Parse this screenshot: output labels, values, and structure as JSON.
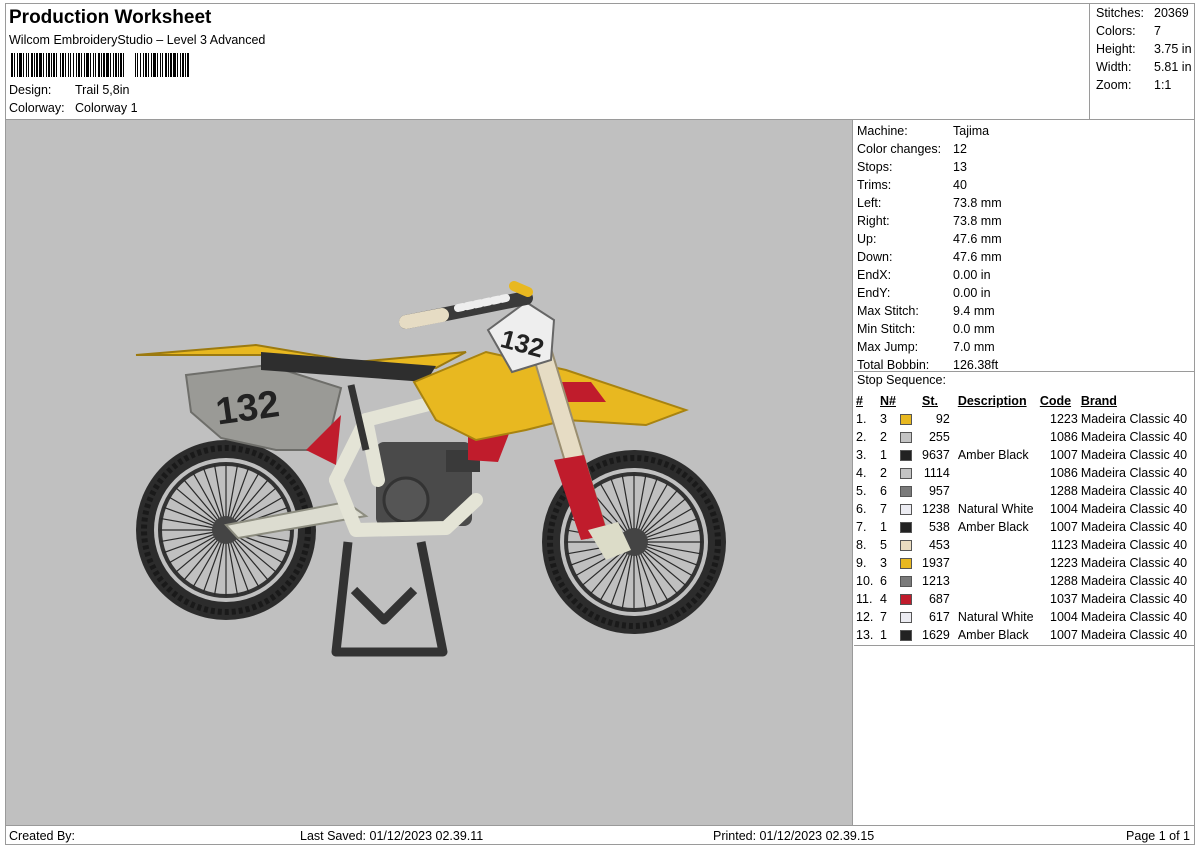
{
  "header": {
    "title": "Production Worksheet",
    "subtitle": "Wilcom EmbroideryStudio – Level 3 Advanced",
    "design_label": "Design:",
    "design_value": "Trail 5,8in",
    "colorway_label": "Colorway:",
    "colorway_value": "Colorway 1"
  },
  "summary": {
    "stitches_label": "Stitches:",
    "stitches_value": "20369",
    "colors_label": "Colors:",
    "colors_value": "7",
    "height_label": "Height:",
    "height_value": "3.75 in",
    "width_label": "Width:",
    "width_value": "5.81 in",
    "zoom_label": "Zoom:",
    "zoom_value": "1:1"
  },
  "machine_info": [
    {
      "label": "Machine:",
      "value": "Tajima"
    },
    {
      "label": "Color changes:",
      "value": "12"
    },
    {
      "label": "Stops:",
      "value": "13"
    },
    {
      "label": "Trims:",
      "value": "40"
    },
    {
      "label": "Left:",
      "value": "73.8 mm"
    },
    {
      "label": "Right:",
      "value": "73.8 mm"
    },
    {
      "label": "Up:",
      "value": "47.6 mm"
    },
    {
      "label": "Down:",
      "value": "47.6 mm"
    },
    {
      "label": "EndX:",
      "value": "0.00 in"
    },
    {
      "label": "EndY:",
      "value": "0.00 in"
    },
    {
      "label": "Max Stitch:",
      "value": "9.4 mm"
    },
    {
      "label": "Min Stitch:",
      "value": "0.0 mm"
    },
    {
      "label": "Max Jump:",
      "value": "7.0 mm"
    },
    {
      "label": "Total Bobbin:",
      "value": "126.38ft"
    }
  ],
  "stop_sequence": {
    "title": "Stop Sequence:",
    "headers": {
      "num": "#",
      "n": "N#",
      "st": "St.",
      "desc": "Description",
      "code": "Code",
      "brand": "Brand"
    },
    "rows": [
      {
        "num": "1.",
        "n": "3",
        "color": "#e8b820",
        "st": "92",
        "desc": "",
        "code": "1223",
        "brand": "Madeira Classic 40"
      },
      {
        "num": "2.",
        "n": "2",
        "color": "#c4c4c4",
        "st": "255",
        "desc": "",
        "code": "1086",
        "brand": "Madeira Classic 40"
      },
      {
        "num": "3.",
        "n": "1",
        "color": "#222222",
        "st": "9637",
        "desc": "Amber Black",
        "code": "1007",
        "brand": "Madeira Classic 40"
      },
      {
        "num": "4.",
        "n": "2",
        "color": "#c4c4c4",
        "st": "1114",
        "desc": "",
        "code": "1086",
        "brand": "Madeira Classic 40"
      },
      {
        "num": "5.",
        "n": "6",
        "color": "#7a7a7a",
        "st": "957",
        "desc": "",
        "code": "1288",
        "brand": "Madeira Classic 40"
      },
      {
        "num": "6.",
        "n": "7",
        "color": "#ececf2",
        "st": "1238",
        "desc": "Natural White",
        "code": "1004",
        "brand": "Madeira Classic 40"
      },
      {
        "num": "7.",
        "n": "1",
        "color": "#222222",
        "st": "538",
        "desc": "Amber Black",
        "code": "1007",
        "brand": "Madeira Classic 40"
      },
      {
        "num": "8.",
        "n": "5",
        "color": "#eadcc0",
        "st": "453",
        "desc": "",
        "code": "1123",
        "brand": "Madeira Classic 40"
      },
      {
        "num": "9.",
        "n": "3",
        "color": "#e8b820",
        "st": "1937",
        "desc": "",
        "code": "1223",
        "brand": "Madeira Classic 40"
      },
      {
        "num": "10.",
        "n": "6",
        "color": "#7a7a7a",
        "st": "1213",
        "desc": "",
        "code": "1288",
        "brand": "Madeira Classic 40"
      },
      {
        "num": "11.",
        "n": "4",
        "color": "#c01c2c",
        "st": "687",
        "desc": "",
        "code": "1037",
        "brand": "Madeira Classic 40"
      },
      {
        "num": "12.",
        "n": "7",
        "color": "#ececf2",
        "st": "617",
        "desc": "Natural White",
        "code": "1004",
        "brand": "Madeira Classic 40"
      },
      {
        "num": "13.",
        "n": "1",
        "color": "#222222",
        "st": "1629",
        "desc": "Amber Black",
        "code": "1007",
        "brand": "Madeira Classic 40"
      }
    ]
  },
  "design_preview": {
    "number_text": "132"
  },
  "footer": {
    "created_by": "Created By:",
    "last_saved": "Last Saved: 01/12/2023 02.39.11",
    "printed": "Printed: 01/12/2023 02.39.15",
    "page": "Page 1 of 1"
  }
}
